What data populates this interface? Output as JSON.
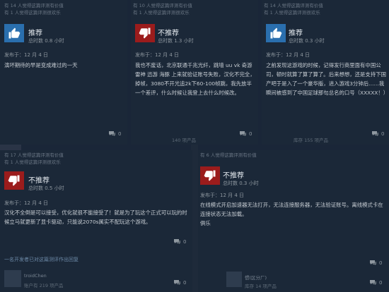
{
  "cards": [
    {
      "helpful": "有 14 人觉得这篇评测有价值",
      "funny": "有 1 人觉得这篇评测很欢乐",
      "verdict": "推荐",
      "hours": "总时数 0.8 小时",
      "posted": "发布于：12 月 4 日",
      "text": "演坏期待的早是变成难过的一天",
      "comments": "0",
      "recommended": true
    },
    {
      "helpful": "有 10 人觉得这篇评测有价值",
      "funny": "有 1 人觉得这篇评测很欢乐",
      "verdict": "不推荐",
      "hours": "总时数 1.3 小时",
      "posted": "发布于：12 月 4 日",
      "text": "我也不废话，北京联通千兆光纤，跳墙 uu vk 奇游 雷神 迅游 海豚 上来就验证账号失败，汉化不完全，掉帧，3080不开光追2k下60-100帧跳，我先放半一个差评，什么时候让我登上去什么时候改。",
      "comments": "0",
      "recommended": false,
      "footer": "140 项产品"
    },
    {
      "helpful": "有 14 人觉得这篇评测有价值",
      "funny": "有 1 人觉得这篇评测很欢乐",
      "verdict": "推荐",
      "hours": "总时数 0.3 小时",
      "posted": "发布于：12 月 4 日",
      "text": "之前发现这游戏的时候，记得发行商里面有中国公司，顿时就算了算了算了。后来想想，还是支持下国产吧于是入了一个豪华版，进入游戏3分钟后……我瞬间被感到了中国足球那句总名的口号（XXXXX！）",
      "comments": "0",
      "recommended": true,
      "footer": "库存 155 项产品"
    },
    {
      "helpful": "有 17 人觉得这篇评测有价值",
      "funny": "有 1 人觉得这篇评测很欢乐",
      "verdict": "不推荐",
      "hours": "总时数 0.5 小时",
      "posted": "发布于：12 月 4 日",
      "text": "汉化不全倒是可以接受，优化就很不能接受了！就是为了玩这个正式可以玩的时候立马就更新了显卡驱动，只能说2070s属实不配玩这个游戏。",
      "comments": "0",
      "recommended": false,
      "link": "一名开发者已对这篇测评作出回复",
      "footer_user": "troidChen",
      "footer": "账户有 219 项产品"
    },
    {
      "helpful": "有 6 人觉得这篇评测有价值",
      "verdict": "不推荐",
      "hours": "总时数 0.3 小时",
      "posted": "发布于：12 月 4 日",
      "text": "在线模式开启加速器无法打开，无法连接服务器，无法验证账号。离线模式卡在连接状态无法加载。\n俱乐",
      "comments": "0",
      "recommended": false,
      "footer_user": "惯(区分厂)",
      "footer": "库存 14 项产品"
    }
  ]
}
